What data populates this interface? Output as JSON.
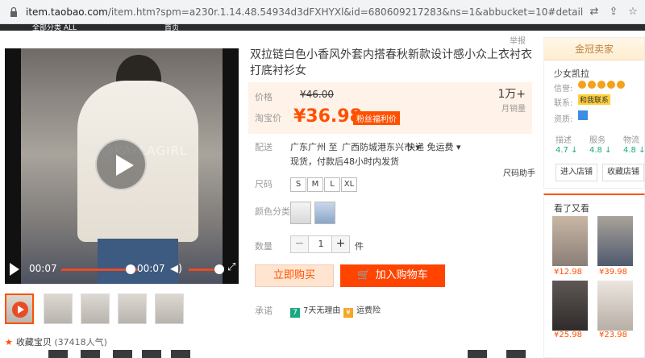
{
  "browser": {
    "url_host": "item.taobao.com",
    "url_rest": "/item.htm?spm=a230r.1.14.48.54934d3dFXHYXl&id=680609217283&ns=1&abbucket=10#detail"
  },
  "nav": {
    "items": [
      "全部分类 ALL",
      "首页"
    ]
  },
  "report_label": "举报",
  "video": {
    "watermark": "@KAYLAGIRL",
    "time_current": "00:07",
    "time_total": "00:07",
    "progress": 1.0
  },
  "favorites": {
    "label": "收藏宝贝",
    "count": "(37418人气)"
  },
  "product": {
    "title": "双拉链白色小香风外套内搭春秋新款设计感小众上衣衬衣打底衬衫女",
    "price_label": "价格",
    "original_price": "¥46.00",
    "taobao_price_label": "淘宝价",
    "current_price": "¥36.98",
    "fan_badge": "粉丝福利价",
    "sales_count": "1万+",
    "sales_label": "月销量",
    "shipping_label": "配送",
    "shipping_from": "广东广州 至",
    "shipping_to": "广西防城港东兴市 ▾",
    "express": "快递 免运费 ▾",
    "delivery_note": "现货，付款后48小时内发货",
    "size_label": "尺码",
    "size_help": "尺码助手",
    "sizes": [
      "S",
      "M",
      "L",
      "XL"
    ],
    "color_label": "颜色分类",
    "colors": [
      "white",
      "blue"
    ],
    "qty_label": "数量",
    "qty_minus": "−",
    "qty_value": "1",
    "qty_plus": "+",
    "qty_unit": "件",
    "buy_now": "立即购买",
    "add_to_cart": "加入购物车",
    "promise_label": "承诺",
    "promise_1": "7天无理由",
    "promise_2": "运费险"
  },
  "seller": {
    "header": "金冠卖家",
    "shop_name": "少女凯拉",
    "credit_label": "信誉:",
    "contact_label": "联系:",
    "contact_ww": "和我联系",
    "qual_label": "资质:",
    "scores": [
      {
        "cat": "描述",
        "val": "4.7 ↓"
      },
      {
        "cat": "服务",
        "val": "4.8 ↓"
      },
      {
        "cat": "物流",
        "val": "4.8 ↓"
      }
    ],
    "enter_shop": "进入店铺",
    "collect_shop": "收藏店铺"
  },
  "see_also": {
    "title": "看了又看",
    "items": [
      {
        "price": "¥12.98"
      },
      {
        "price": "¥39.98"
      },
      {
        "price": "¥25.98"
      },
      {
        "price": "¥23.98"
      }
    ]
  },
  "colors": {
    "accent": "#ff5000",
    "cart": "#ff4400",
    "price_bg": "#fff2e8"
  }
}
